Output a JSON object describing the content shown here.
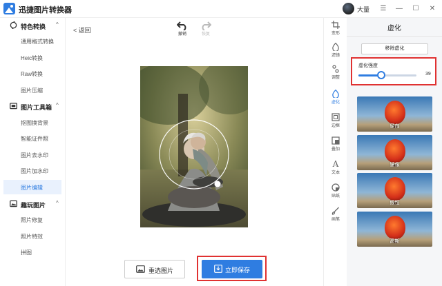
{
  "app": {
    "title": "迅捷图片转换器"
  },
  "user": {
    "name": "大量"
  },
  "window_controls": {
    "menu": "☰",
    "minimize": "—",
    "maximize": "☐",
    "close": "✕"
  },
  "sidebar": {
    "categories": [
      {
        "label": "特色转换",
        "items": [
          "通用格式转换",
          "Heic转换",
          "Raw转换",
          "图片压缩"
        ]
      },
      {
        "label": "图片工具箱",
        "items": [
          "抠图换背景",
          "智能证件照",
          "图片去水印",
          "图片加水印",
          "图片编辑"
        ]
      },
      {
        "label": "趣玩图片",
        "items": [
          "照片修复",
          "照片特效",
          "拼图"
        ]
      }
    ],
    "active_item": "图片编辑"
  },
  "editor": {
    "back_label": "返回",
    "undo_label": "撤销",
    "redo_label": "恢复",
    "reselect_label": "重选图片",
    "save_label": "立即保存"
  },
  "right_toolbar": {
    "tools": [
      "变形",
      "滤镜",
      "调整",
      "虚化",
      "边框",
      "叠加",
      "文本",
      "贴纸",
      "画笔"
    ],
    "active_tool": "虚化"
  },
  "panel": {
    "title": "虚化",
    "remove_button": "移除虚化",
    "strength_label": "虚化强度",
    "strength_value": "39",
    "strength_fraction": 0.39,
    "presets": [
      "径向",
      "镜像",
      "线性",
      "高斯"
    ]
  },
  "colors": {
    "accent": "#2f7de1",
    "highlight": "#e03131",
    "active_bg": "#e9f1fd"
  }
}
